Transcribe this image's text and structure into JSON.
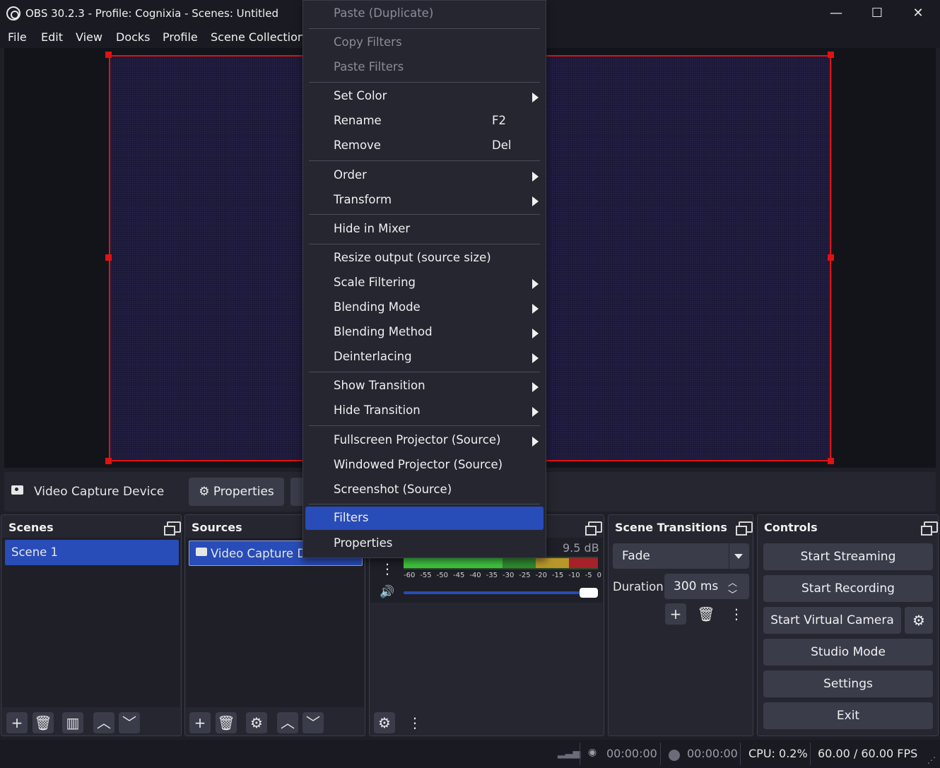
{
  "window": {
    "title": "OBS 30.2.3 - Profile: Cognixia - Scenes: Untitled",
    "minimize": "—",
    "maximize": "☐",
    "close": "✕"
  },
  "menubar": [
    "File",
    "Edit",
    "View",
    "Docks",
    "Profile",
    "Scene Collection"
  ],
  "source_toolbar": {
    "source_name": "Video Capture Device",
    "properties_label": "Properties"
  },
  "context_menu": {
    "items": [
      {
        "label": "Paste (Duplicate)",
        "disabled": true
      },
      {
        "label": "Copy Filters",
        "disabled": true
      },
      {
        "label": "Paste Filters",
        "disabled": true
      },
      {
        "label": "Set Color",
        "submenu": true
      },
      {
        "label": "Rename",
        "shortcut": "F2"
      },
      {
        "label": "Remove",
        "shortcut": "Del"
      },
      {
        "label": "Order",
        "submenu": true
      },
      {
        "label": "Transform",
        "submenu": true
      },
      {
        "label": "Hide in Mixer"
      },
      {
        "label": "Resize output (source size)"
      },
      {
        "label": "Scale Filtering",
        "submenu": true
      },
      {
        "label": "Blending Mode",
        "submenu": true
      },
      {
        "label": "Blending Method",
        "submenu": true
      },
      {
        "label": "Deinterlacing",
        "submenu": true
      },
      {
        "label": "Show Transition",
        "submenu": true
      },
      {
        "label": "Hide Transition",
        "submenu": true
      },
      {
        "label": "Fullscreen Projector (Source)",
        "submenu": true
      },
      {
        "label": "Windowed Projector (Source)"
      },
      {
        "label": "Screenshot (Source)"
      },
      {
        "label": "Filters",
        "highlighted": true
      },
      {
        "label": "Properties"
      }
    ]
  },
  "scenes": {
    "title": "Scenes",
    "items": [
      "Scene 1"
    ]
  },
  "sources": {
    "title": "Sources",
    "items": [
      "Video Capture De"
    ]
  },
  "mixer": {
    "db_value": "9.5 dB",
    "ticks": [
      "-60",
      "-55",
      "-50",
      "-45",
      "-40",
      "-35",
      "-30",
      "-25",
      "-20",
      "-15",
      "-10",
      "-5",
      "0"
    ],
    "volume_fraction": 1.0
  },
  "transitions": {
    "title": "Scene Transitions",
    "selected": "Fade",
    "duration_label": "Duration",
    "duration_value": "300 ms"
  },
  "controls": {
    "title": "Controls",
    "start_streaming": "Start Streaming",
    "start_recording": "Start Recording",
    "start_virtual_camera": "Start Virtual Camera",
    "studio_mode": "Studio Mode",
    "settings": "Settings",
    "exit": "Exit"
  },
  "status": {
    "stream_time": "00:00:00",
    "record_time": "00:00:00",
    "cpu": "CPU: 0.2%",
    "fps": "60.00 / 60.00 FPS"
  },
  "colors": {
    "accent": "#284cb8",
    "selection_border": "#e11212",
    "meter_green": "#3ec43e",
    "meter_yellow": "#b8962a",
    "meter_red": "#a8202a"
  }
}
